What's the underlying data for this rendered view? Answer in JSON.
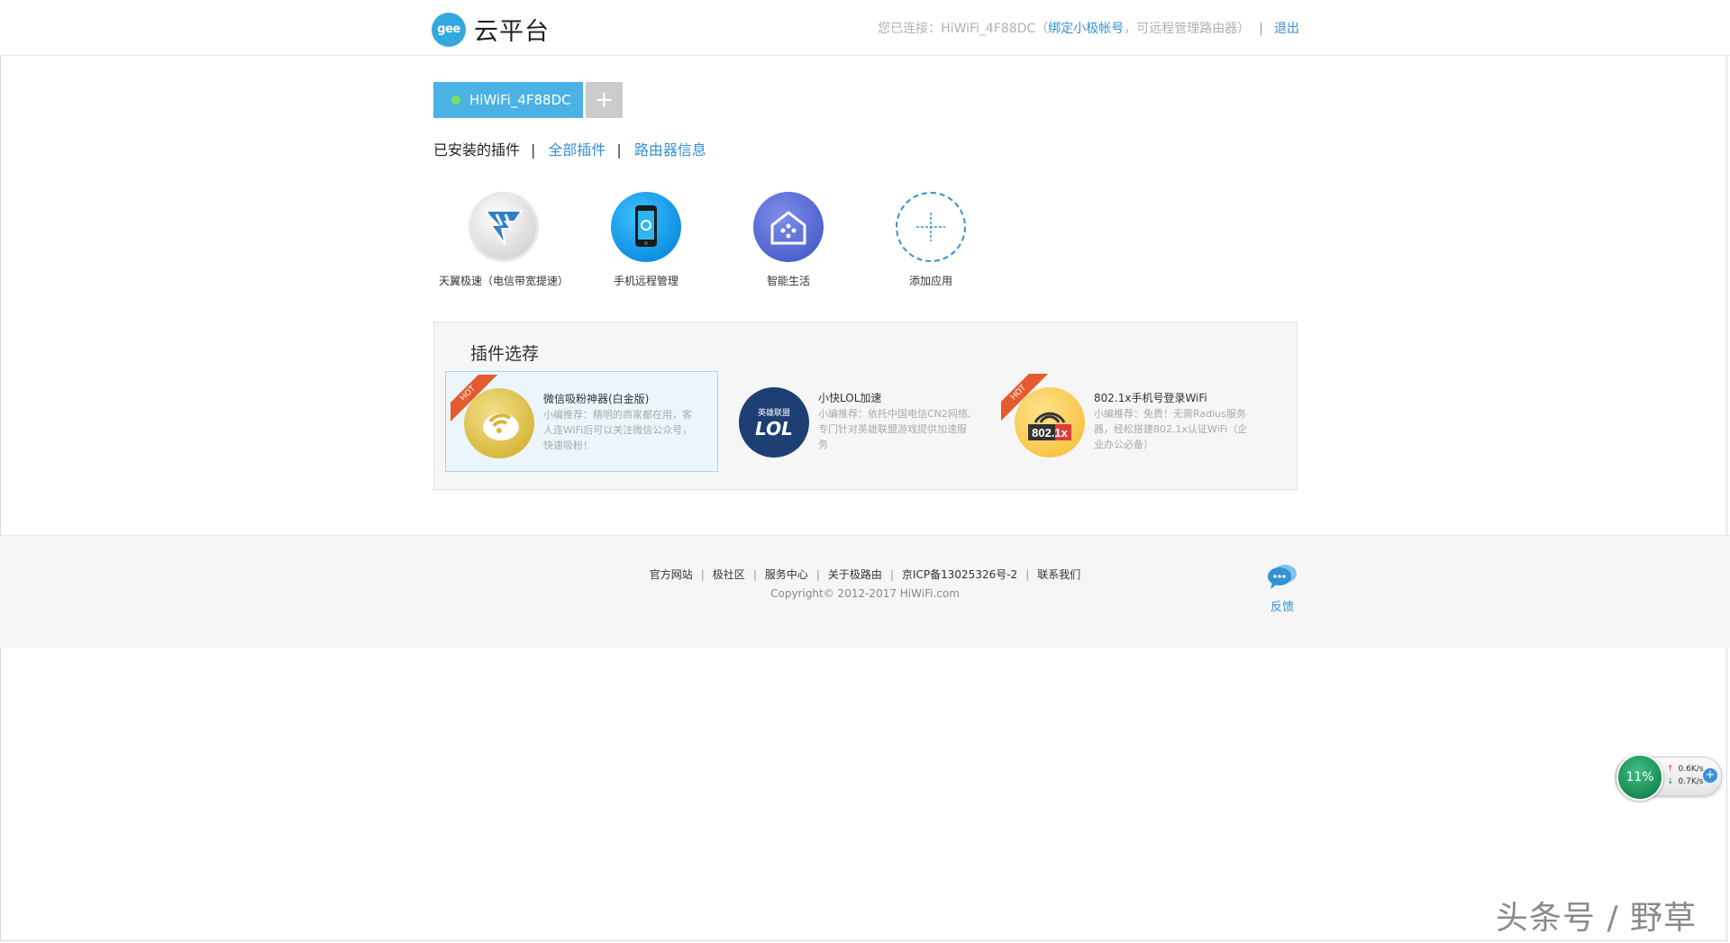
{
  "header": {
    "logo_badge": "gee",
    "logo_text": "云平台",
    "conn_prefix": "您已连接：HiWiFi_4F88DC（",
    "bind_link": "绑定小极帐号",
    "conn_suffix": "，可远程管理路由器）",
    "separator": "|",
    "logout": "退出"
  },
  "router": {
    "name": "HiWiFi_4F88DC",
    "add_label": "+"
  },
  "nav": {
    "installed": "已安装的插件",
    "all": "全部插件",
    "info": "路由器信息",
    "bar": "|"
  },
  "installed_plugins": [
    {
      "name": "天翼极速（电信带宽提速）",
      "icon": "tianyi-speed-icon"
    },
    {
      "name": "手机远程管理",
      "icon": "phone-remote-icon"
    },
    {
      "name": "智能生活",
      "icon": "smart-home-icon"
    },
    {
      "name": "添加应用",
      "icon": "add-app-icon"
    }
  ],
  "recommend": {
    "title": "插件选荐",
    "hot_label": "HOT",
    "items": [
      {
        "name": "微信吸粉神器(白金版)",
        "desc": "小编推荐：精明的商家都在用，客人连WiFi后可以关注微信公众号，快速吸粉！"
      },
      {
        "name": "小快LOL加速",
        "desc": "小编推荐：依托中国电信CN2网络,专门针对英雄联盟游戏提供加速服务",
        "icon_text_top": "英雄联盟",
        "icon_text_main": "LOL"
      },
      {
        "name": "802.1x手机号登录WiFi",
        "desc": "小编推荐：免费！无需Radius服务器，经松搭建802.1x认证WiFi（企业办公必备）",
        "icon_text": "802.1x"
      }
    ]
  },
  "footer": {
    "links": [
      "官方网站",
      "极社区",
      "服务中心",
      "关于极路由",
      "京ICP备13025326号-2",
      "联系我们"
    ],
    "separator": "|",
    "copyright": "Copyright© 2012-2017 HiWiFi.com",
    "feedback": "反馈"
  },
  "speed_widget": {
    "percent": "11%",
    "up": "0.6K/s",
    "down": "0.7K/s",
    "up_arrow": "↑",
    "down_arrow": "↓",
    "plus": "+"
  },
  "watermark": "头条号 / 野草",
  "colors": {
    "accent": "#3391d6",
    "tab": "#4bb2e5",
    "hot": "#e55a2e"
  }
}
